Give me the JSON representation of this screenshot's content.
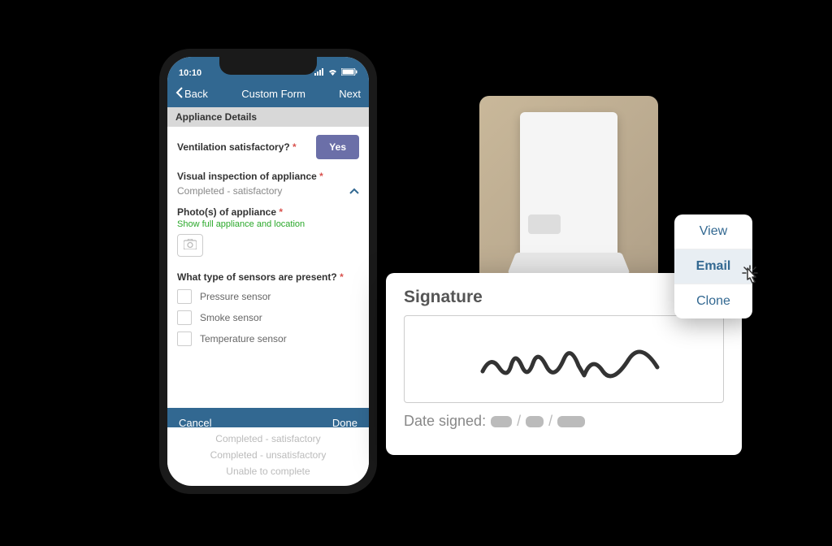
{
  "statusbar": {
    "time": "10:10"
  },
  "nav": {
    "back": "Back",
    "title": "Custom Form",
    "next": "Next"
  },
  "section_header": "Appliance Details",
  "fields": {
    "ventilation": {
      "label": "Ventilation satisfactory?",
      "value": "Yes"
    },
    "visual_inspection": {
      "label": "Visual inspection of appliance",
      "selected": "Completed - satisfactory"
    },
    "photos": {
      "label": "Photo(s) of appliance",
      "hint": "Show full appliance and location"
    },
    "sensors": {
      "label": "What type of sensors are present?",
      "options": [
        "Pressure sensor",
        "Smoke sensor",
        "Temperature sensor"
      ]
    }
  },
  "bottom_bar": {
    "cancel": "Cancel",
    "done": "Done"
  },
  "dropdown_options": [
    "Completed - satisfactory",
    "Completed - unsatisfactory",
    "Unable to complete"
  ],
  "signature": {
    "title": "Signature",
    "date_label": "Date signed:"
  },
  "menu": {
    "items": [
      "View",
      "Email",
      "Clone"
    ]
  }
}
